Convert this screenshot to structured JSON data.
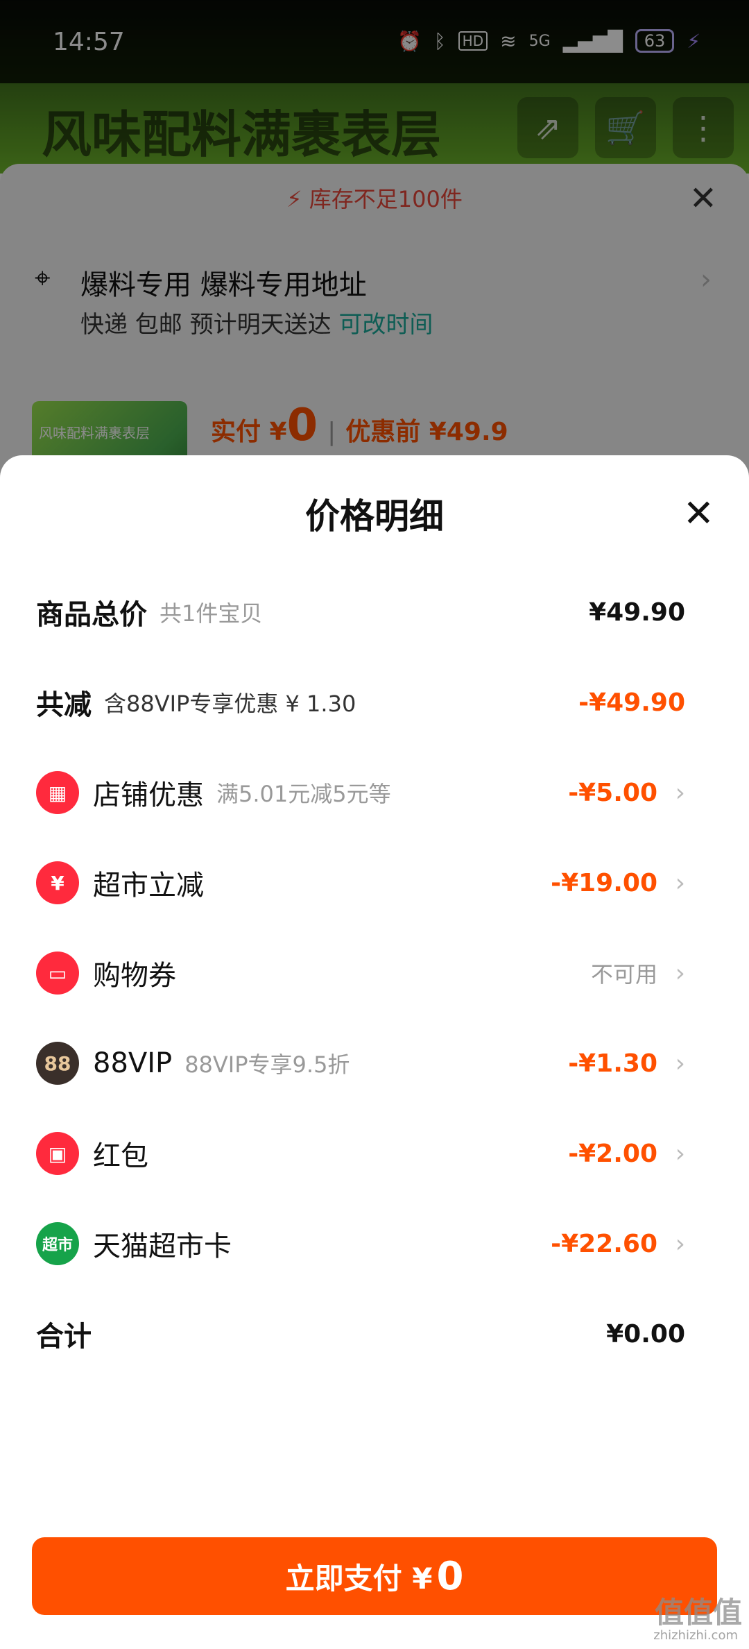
{
  "status": {
    "time": "14:57",
    "network": "5G",
    "battery": "63"
  },
  "background": {
    "banner_title": "风味配料满裹表层",
    "stock_warning": "库存不足100件",
    "address_line": "爆料专用 爆料专用地址",
    "shipping_text": "快递 包邮 预计明天送达",
    "shipping_link": "可改时间",
    "pay_prefix": "实付 ¥",
    "pay_amount": "0",
    "before_discount": "优惠前 ¥49.9"
  },
  "sheet": {
    "title": "价格明细",
    "rows": [
      {
        "label": "商品总价",
        "sub": "共1件宝贝",
        "amount": "¥49.90"
      },
      {
        "label": "共减",
        "sub": "含88VIP专享优惠 ¥ 1.30",
        "amount": "-¥49.90"
      },
      {
        "label": "店铺优惠",
        "sub": "满5.01元减5元等",
        "amount": "-¥5.00"
      },
      {
        "label": "超市立减",
        "sub": "",
        "amount": "-¥19.00"
      },
      {
        "label": "购物券",
        "sub": "",
        "amount": "不可用"
      },
      {
        "label": "88VIP",
        "sub": "88VIP专享9.5折",
        "amount": "-¥1.30"
      },
      {
        "label": "红包",
        "sub": "",
        "amount": "-¥2.00"
      },
      {
        "label": "天猫超市卡",
        "sub": "",
        "amount": "-¥22.60"
      },
      {
        "label": "合计",
        "sub": "",
        "amount": "¥0.00"
      }
    ],
    "pay_button_label": "立即支付 ¥",
    "pay_button_amount": "0"
  },
  "icons": {
    "shop": "store-icon",
    "supermarket": "yuan-icon",
    "coupon": "ticket-icon",
    "vip": "88vip-icon",
    "red_packet": "red-envelope-icon",
    "tmall_card": "tmall-supermarket-icon"
  },
  "colors": {
    "accent": "#ff5000",
    "link": "#1aa99a",
    "warning": "#e8463a"
  },
  "watermark": {
    "text": "值值值",
    "domain": "zhizhizhi.com"
  }
}
